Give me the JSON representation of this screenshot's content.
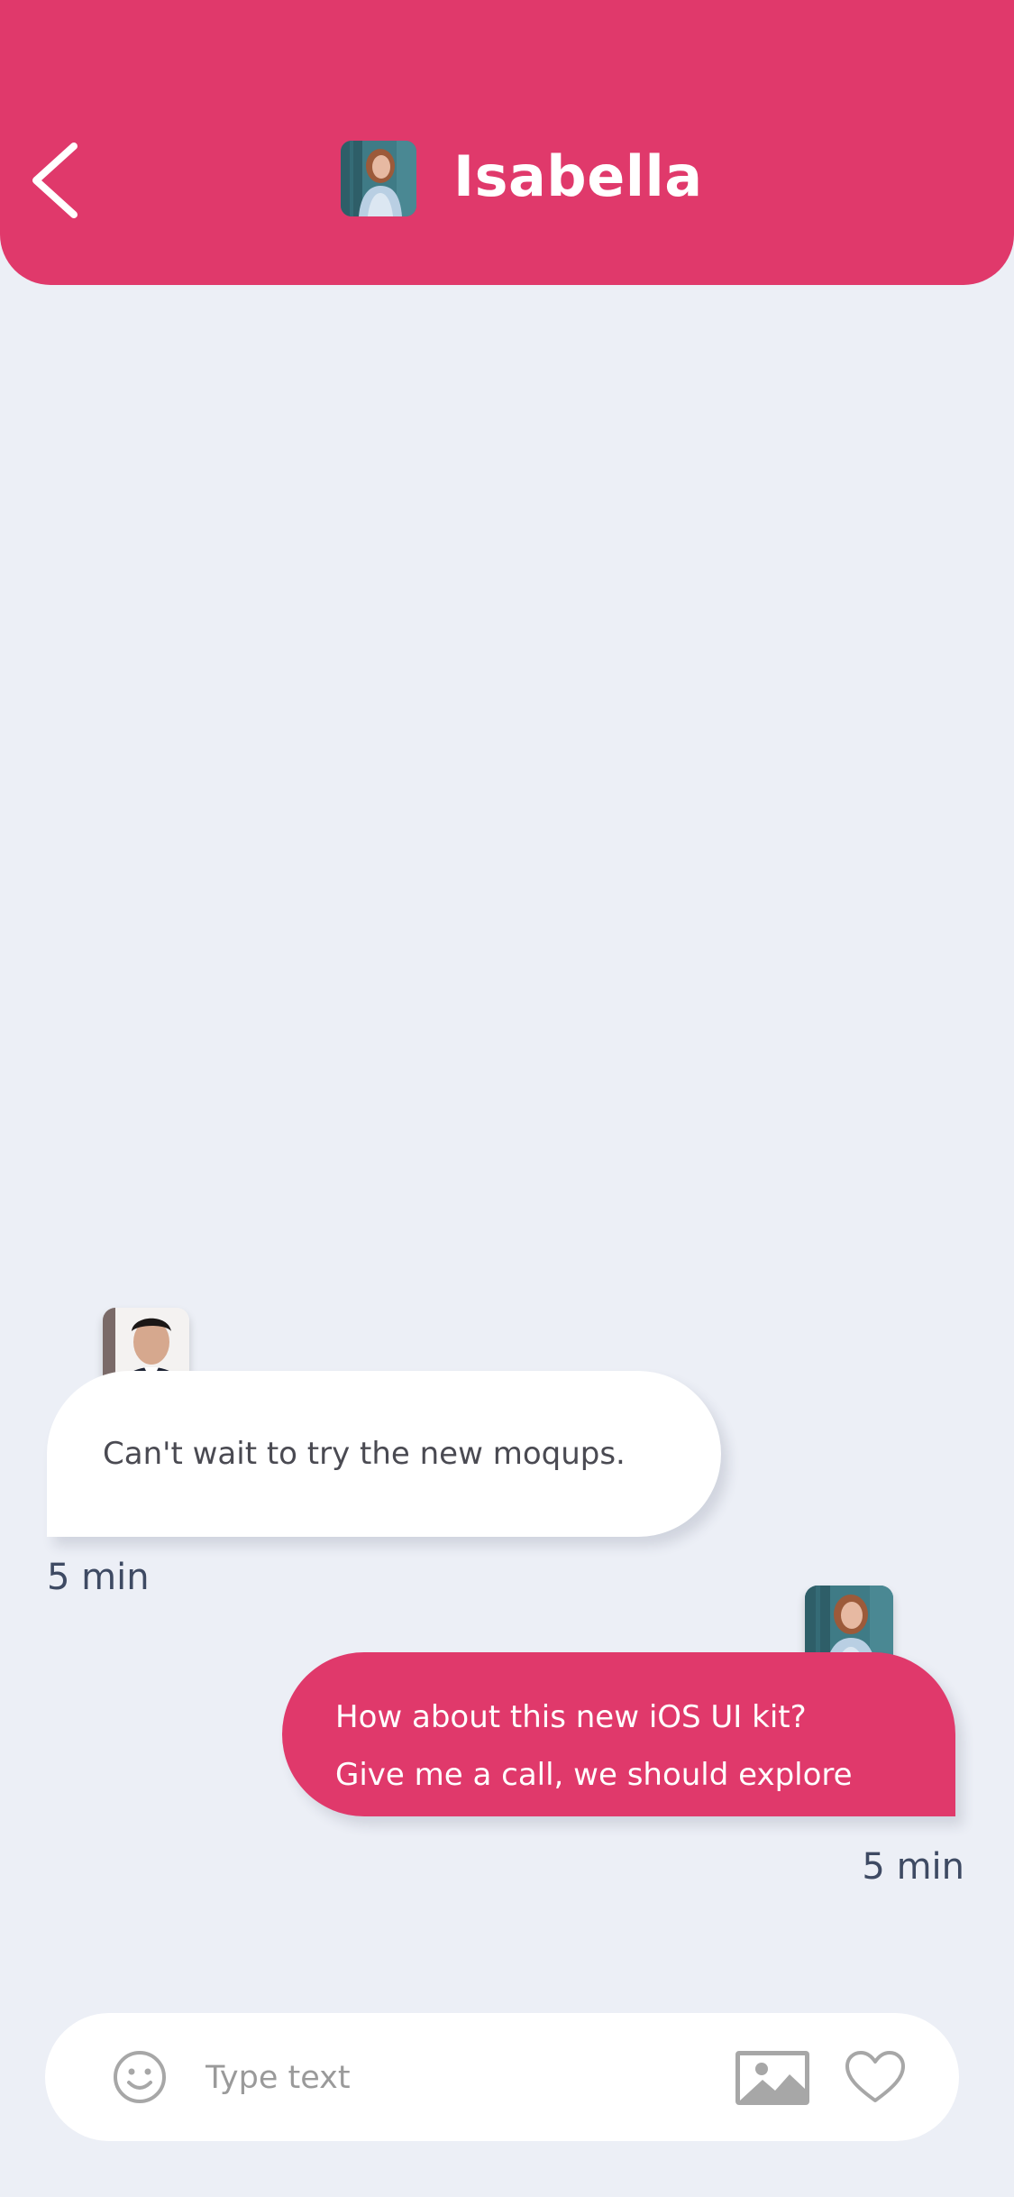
{
  "header": {
    "contact_name": "Isabella",
    "back_icon": "chevron-left-icon",
    "background_color": "#E0396B"
  },
  "messages": [
    {
      "direction": "incoming",
      "text": "Can't wait to try the new moqups.",
      "time": "5 min"
    },
    {
      "direction": "outgoing",
      "lines": [
        "How about this new iOS UI kit?",
        "Give me a call, we should explore"
      ],
      "time": "5 min"
    }
  ],
  "composer": {
    "placeholder": "Type text",
    "value": "",
    "icons": [
      "smiley-icon",
      "image-icon",
      "heart-icon"
    ]
  },
  "colors": {
    "accent": "#E0396B",
    "background": "#ECEFF6",
    "bubble_incoming": "#FFFFFF",
    "time_text": "#3E4A63"
  }
}
